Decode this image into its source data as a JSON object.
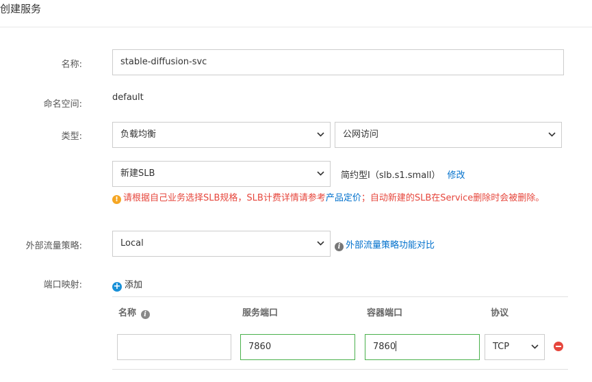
{
  "header": {
    "title": "创建服务"
  },
  "form": {
    "name": {
      "label": "名称:",
      "value": "stable-diffusion-svc"
    },
    "namespace": {
      "label": "命名空间:",
      "value": "default"
    },
    "type": {
      "label": "类型:",
      "select1": "负载均衡",
      "select2": "公网访问"
    },
    "slb": {
      "select": "新建SLB",
      "spec_text": "简约型I（slb.s1.small）",
      "edit_link": "修改"
    },
    "warning": {
      "part1": "请根据自己业务选择SLB规格，SLB计费详情请参考",
      "link": "产品定价",
      "part2": "；自动新建的SLB在Service删除时会被删除。"
    },
    "traffic": {
      "label": "外部流量策略:",
      "select": "Local",
      "help_link": "外部流量策略功能对比"
    },
    "ports": {
      "label": "端口映射:",
      "add_label": "添加",
      "columns": [
        "名称",
        "服务端口",
        "容器端口",
        "协议"
      ],
      "row": {
        "name": "",
        "service_port": "7860",
        "container_port": "7860",
        "protocol": "TCP"
      }
    }
  },
  "colors": {
    "accent": "#0070cc",
    "error": "#e6463c",
    "warning_icon": "#f5a623",
    "valid_border": "#48b04a"
  },
  "icons": [
    "chevron-down-icon",
    "warning-icon",
    "info-icon",
    "add-icon",
    "remove-icon"
  ]
}
